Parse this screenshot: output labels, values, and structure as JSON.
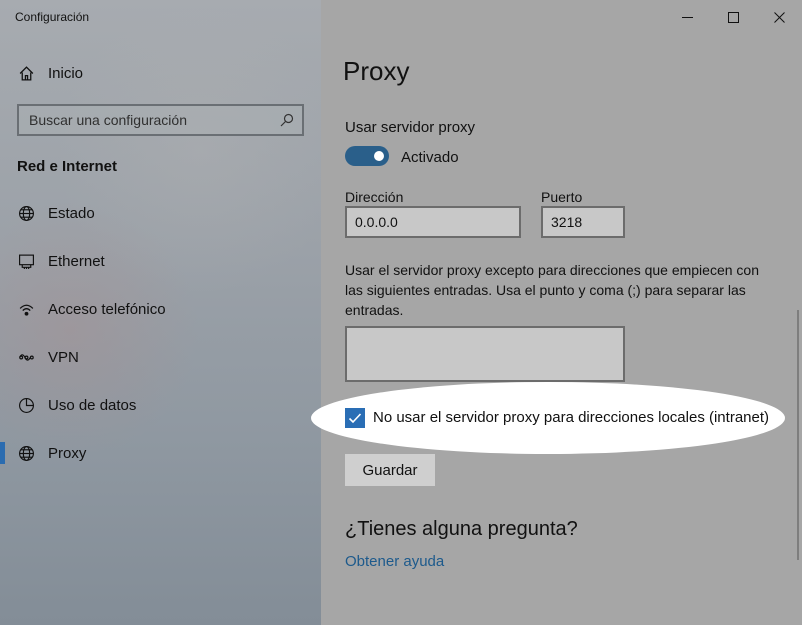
{
  "window": {
    "title": "Configuración",
    "accent_color": "#2a6eb5"
  },
  "sidebar": {
    "home_label": "Inicio",
    "search_placeholder": "Buscar una configuración",
    "section_title": "Red e Internet",
    "items": [
      {
        "label": "Estado",
        "icon": "globe-status-icon"
      },
      {
        "label": "Ethernet",
        "icon": "ethernet-icon"
      },
      {
        "label": "Acceso telefónico",
        "icon": "dialup-icon"
      },
      {
        "label": "VPN",
        "icon": "vpn-icon"
      },
      {
        "label": "Uso de datos",
        "icon": "data-usage-icon"
      },
      {
        "label": "Proxy",
        "icon": "globe-icon",
        "active": true
      }
    ]
  },
  "main": {
    "title": "Proxy",
    "use_proxy_label": "Usar servidor proxy",
    "toggle_state": "Activado",
    "address_label": "Dirección",
    "address_value": "0.0.0.0",
    "port_label": "Puerto",
    "port_value": "3218",
    "exceptions_description": "Usar el servidor proxy excepto para direcciones que empiecen con las siguientes entradas. Usa el punto y coma (;) para separar las entradas.",
    "exceptions_value": "",
    "bypass_local_label": "No usar el servidor proxy para direcciones locales (intranet)",
    "bypass_local_checked": true,
    "save_label": "Guardar",
    "question_heading": "¿Tienes alguna pregunta?",
    "help_link": "Obtener ayuda"
  }
}
